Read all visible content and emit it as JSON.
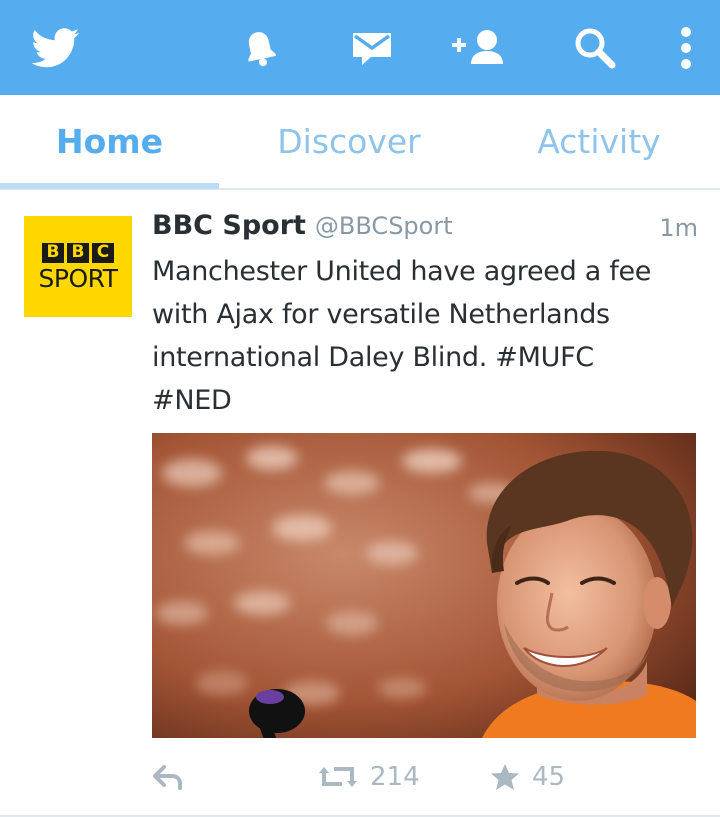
{
  "app": {
    "accent_color": "#55acee",
    "icons": [
      "twitter-bird-icon",
      "notifications-bell-icon",
      "messages-envelope-icon",
      "add-user-icon",
      "search-icon",
      "overflow-menu-icon"
    ]
  },
  "tabs": [
    {
      "label": "Home",
      "active": true
    },
    {
      "label": "Discover",
      "active": false
    },
    {
      "label": "Activity",
      "active": false
    }
  ],
  "tweet": {
    "avatar": {
      "logo_letters": [
        "B",
        "B",
        "C"
      ],
      "logo_word": "SPORT",
      "background": "#ffd700"
    },
    "display_name": "BBC Sport",
    "handle": "@BBCSport",
    "time": "1m",
    "text_lines": [
      "Manchester United have agreed a fee",
      "with Ajax for versatile Netherlands",
      "international Daley Blind. #MUFC",
      "#NED"
    ],
    "media": {
      "kind": "photo",
      "icon": "tweet-photo"
    },
    "actions": {
      "reply": {
        "icon": "reply-icon"
      },
      "retweet": {
        "icon": "retweet-icon",
        "count": "214"
      },
      "favorite": {
        "icon": "star-icon",
        "count": "45"
      }
    }
  }
}
